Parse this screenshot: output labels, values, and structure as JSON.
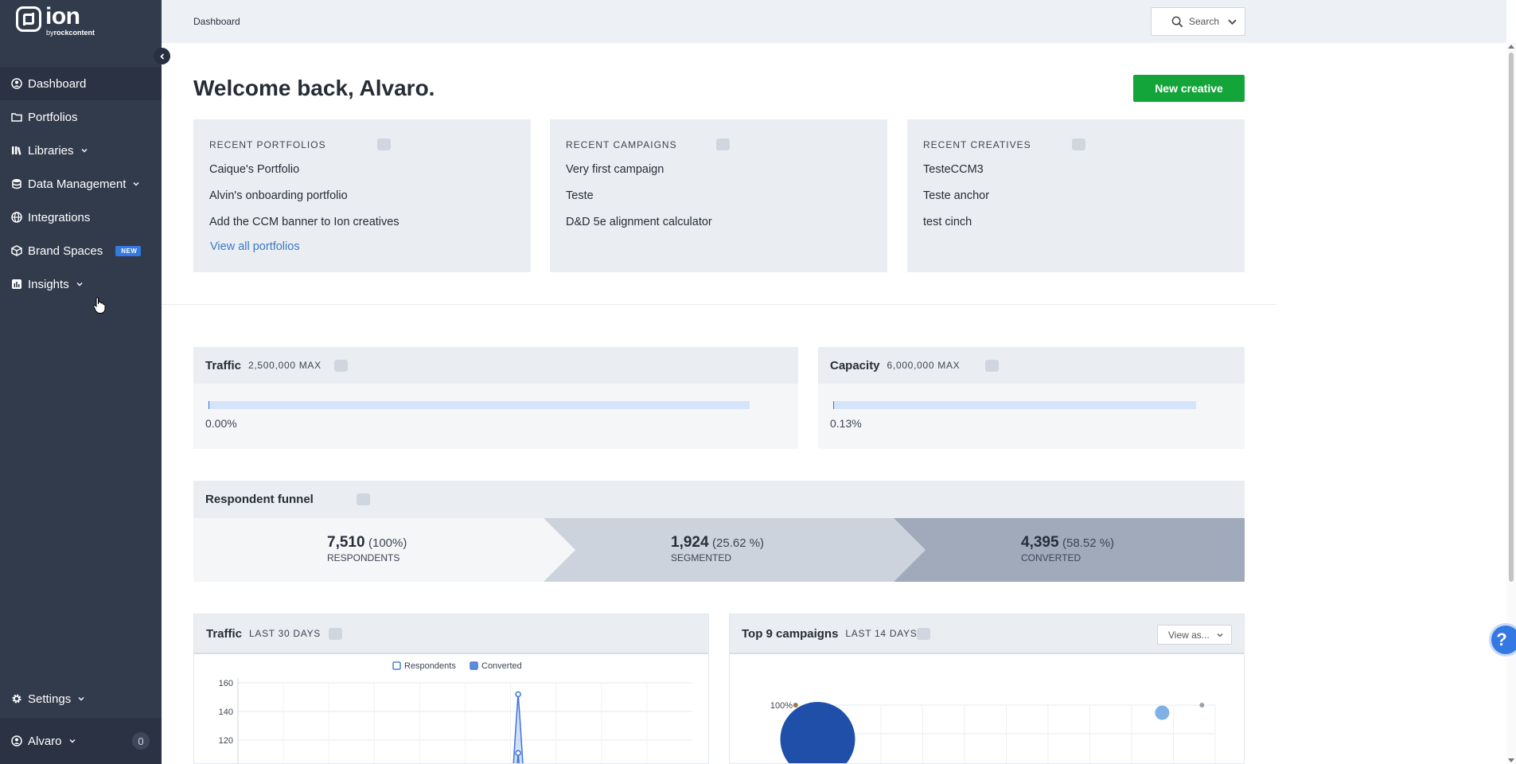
{
  "brand": {
    "word": "ion",
    "by_prefix": "by",
    "by_name": "rockcontent"
  },
  "sidebar": {
    "items": [
      {
        "label": "Dashboard",
        "icon": "user-circle-icon",
        "active": true
      },
      {
        "label": "Portfolios",
        "icon": "folder-icon"
      },
      {
        "label": "Libraries",
        "icon": "books-icon",
        "has_children": true
      },
      {
        "label": "Data Management",
        "icon": "database-icon",
        "has_children": true
      },
      {
        "label": "Integrations",
        "icon": "globe-icon"
      },
      {
        "label": "Brand Spaces",
        "icon": "cube-icon",
        "badge": "NEW"
      },
      {
        "label": "Insights",
        "icon": "bar-chart-icon",
        "has_children": true
      }
    ],
    "settings_label": "Settings",
    "user_name": "Alvaro",
    "notification_count": "0"
  },
  "header": {
    "breadcrumb": "Dashboard",
    "search_label": "Search"
  },
  "main": {
    "welcome": "Welcome back, Alvaro.",
    "new_creative_label": "New creative",
    "recent": [
      {
        "title": "RECENT PORTFOLIOS",
        "items": [
          "Caique's Portfolio",
          "Alvin's onboarding portfolio",
          "Add the CCM banner to Ion creatives"
        ],
        "link": "View all portfolios"
      },
      {
        "title": "RECENT CAMPAIGNS",
        "items": [
          "Very first campaign",
          "Teste",
          "D&D 5e alignment calculator"
        ]
      },
      {
        "title": "RECENT CREATIVES",
        "items": [
          "TesteCCM3",
          "Teste anchor",
          "test cinch"
        ]
      }
    ],
    "traffic_meter": {
      "title": "Traffic",
      "max": "2,500,000 MAX",
      "percent_label": "0.00%",
      "fraction": 0.0
    },
    "capacity_meter": {
      "title": "Capacity",
      "max": "6,000,000 MAX",
      "percent_label": "0.13%",
      "fraction": 0.0013
    },
    "funnel": {
      "title": "Respondent funnel",
      "stages": [
        {
          "value": "7,510",
          "pct": "(100%)",
          "label": "RESPONDENTS"
        },
        {
          "value": "1,924",
          "pct": "(25.62 %)",
          "label": "SEGMENTED"
        },
        {
          "value": "4,395",
          "pct": "(58.52 %)",
          "label": "CONVERTED"
        }
      ]
    },
    "traffic_chart_card": {
      "title": "Traffic",
      "subtitle": "LAST 30 DAYS"
    },
    "campaigns_card": {
      "title": "Top 9 campaigns",
      "subtitle": "LAST 14 DAYS",
      "view_as_label": "View as..."
    }
  },
  "colors": {
    "sidebar": "#323b4c",
    "accent_green": "#14a53a",
    "accent_blue": "#3479e3",
    "respondents_series": "#4a7fd4",
    "converted_series": "#5b8fd6"
  },
  "chart_data": [
    {
      "type": "line",
      "legend": [
        "Respondents",
        "Converted"
      ],
      "legend_position": "top-center",
      "y_ticks": [
        160,
        140,
        120
      ],
      "ylim": [
        100,
        160
      ],
      "grid": true,
      "series": [
        {
          "name": "Respondents",
          "peak_value": 152,
          "peak_index": 18
        },
        {
          "name": "Converted",
          "peak_value": 111,
          "peak_index": 18
        }
      ],
      "points_count": 30
    },
    {
      "type": "scatter",
      "y_ticks": [
        "100%"
      ],
      "ylim": [
        0,
        100
      ],
      "grid": true,
      "points": [
        {
          "x": 0.05,
          "y": 100,
          "size": 2,
          "color": "#9a7a4a"
        },
        {
          "x": 0.1,
          "y": 85,
          "size": 40,
          "color": "#1f4fa8"
        },
        {
          "x": 0.88,
          "y": 92,
          "size": 8,
          "color": "#7fb0e6"
        },
        {
          "x": 0.97,
          "y": 100,
          "size": 2,
          "color": "#9aa0a8"
        }
      ]
    }
  ]
}
